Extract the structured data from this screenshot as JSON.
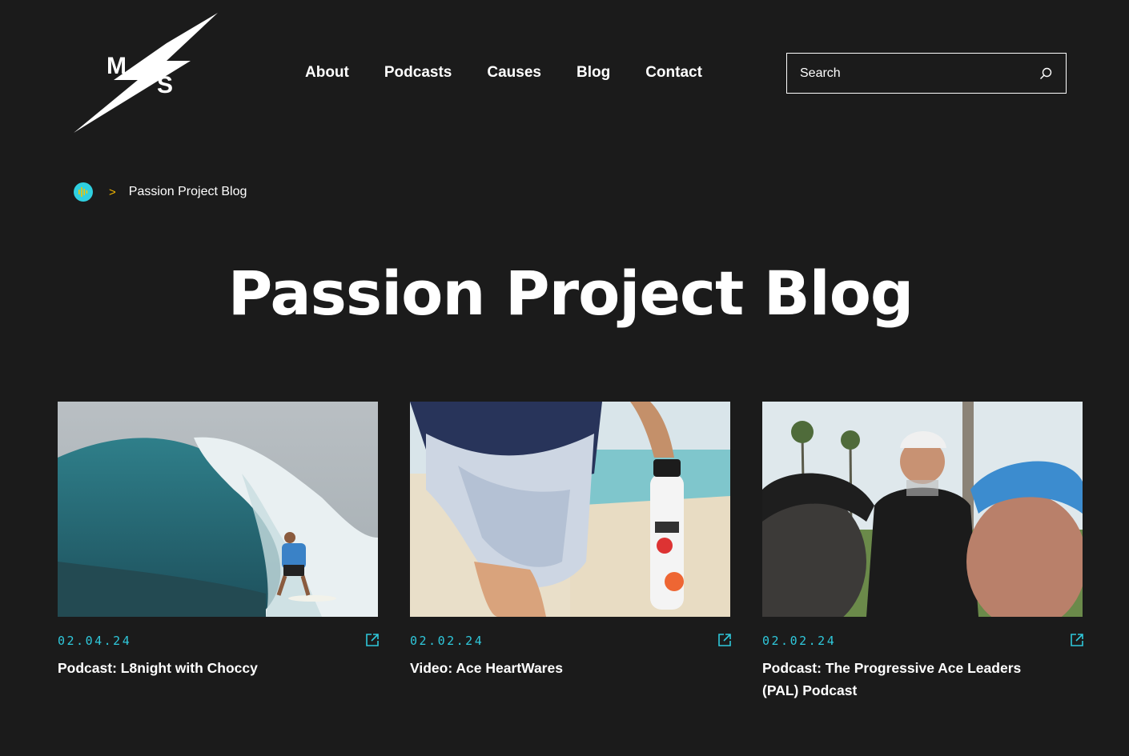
{
  "brand": {
    "logo_letters": [
      "M",
      "S"
    ]
  },
  "nav": {
    "items": [
      {
        "label": "About"
      },
      {
        "label": "Podcasts"
      },
      {
        "label": "Causes"
      },
      {
        "label": "Blog"
      },
      {
        "label": "Contact"
      }
    ]
  },
  "search": {
    "placeholder": "Search",
    "icon": "search-icon"
  },
  "breadcrumb": {
    "separator": ">",
    "current": "Passion Project Blog",
    "home_icon": "podcast-home-icon"
  },
  "page": {
    "title": "Passion Project Blog"
  },
  "posts": [
    {
      "date": "02.04.24",
      "title": "Podcast: L8night with Choccy",
      "image": "surfer riding a wave"
    },
    {
      "date": "02.02.24",
      "title": "Video: Ace HeartWares",
      "image": "water bottle on beach"
    },
    {
      "date": "02.02.24",
      "title": "Podcast: The Progressive Ace Leaders (PAL) Podcast",
      "image": "man with kids at park"
    }
  ],
  "colors": {
    "background": "#1b1b1b",
    "accent_cyan": "#2fc8db",
    "separator_yellow": "#f5b800",
    "text": "#ffffff"
  }
}
